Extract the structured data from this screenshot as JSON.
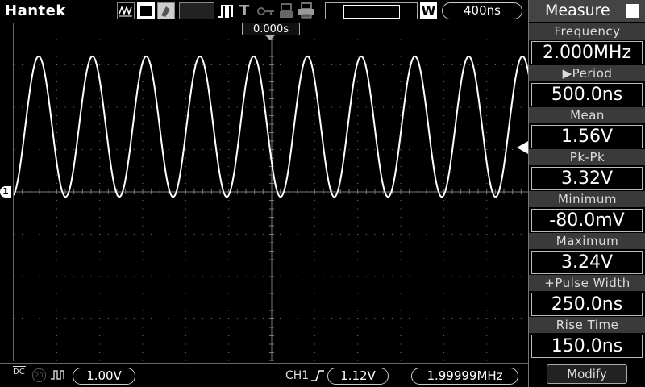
{
  "brand": "Hantek",
  "top": {
    "status_icons": [
      "waveform-mode-icon",
      "run-icon",
      "probe-icon",
      "pulse-icon",
      "trigger-icon",
      "key-icon",
      "usb-icon",
      "print-icon"
    ],
    "trigger_letter": "T",
    "window_letter": "W",
    "timebase": "400ns",
    "trigger_position": "0.000s"
  },
  "channel": {
    "marker": "1",
    "volts_div": "1.00V",
    "coupling": "DC",
    "bw_limit": "20",
    "trigger_source": "CH1",
    "trigger_level": "1.12V",
    "trigger_freq": "1.99999MHz"
  },
  "signal": {
    "frequency_hz": 2000000,
    "period_ns": 500,
    "min_v": -0.08,
    "max_v": 3.24,
    "timebase_ns_per_div": 400,
    "volts_per_div": 1.0
  },
  "panel": {
    "title": "Measure",
    "measurements": [
      {
        "label": "Frequency",
        "value": "2.000MHz"
      },
      {
        "label": "▶Period",
        "value": "500.0ns"
      },
      {
        "label": "Mean",
        "value": "1.56V"
      },
      {
        "label": "Pk-Pk",
        "value": "3.32V"
      },
      {
        "label": "Minimum",
        "value": "-80.0mV"
      },
      {
        "label": "Maximum",
        "value": "3.24V"
      },
      {
        "label": "+Pulse Width",
        "value": "250.0ns"
      },
      {
        "label": "Rise Time",
        "value": "150.0ns"
      }
    ],
    "modify_label": "Modify"
  },
  "colors": {
    "trace": "#ffffff",
    "grid": "#7a7a7a",
    "background": "#000000"
  }
}
